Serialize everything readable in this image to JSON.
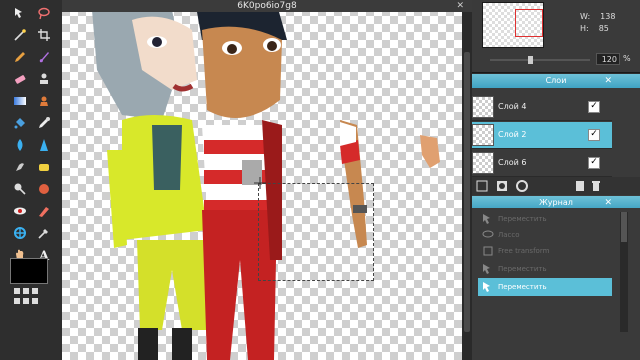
{
  "document": {
    "title": "6K0po6io7g8"
  },
  "navigator": {
    "width_label": "W:",
    "width_value": "138",
    "height_label": "H:",
    "height_value": "85",
    "zoom_value": "120",
    "zoom_unit": "%"
  },
  "layers_panel": {
    "title": "Слои",
    "items": [
      {
        "name": "Слой 4",
        "selected": false,
        "visible": true
      },
      {
        "name": "Слой 2",
        "selected": true,
        "visible": true
      },
      {
        "name": "Слой 6",
        "selected": false,
        "visible": true
      }
    ]
  },
  "history_panel": {
    "title": "Журнал",
    "items": [
      {
        "label": "Переместить",
        "selected": false
      },
      {
        "label": "Лассо",
        "selected": false
      },
      {
        "label": "Free transform",
        "selected": false
      },
      {
        "label": "Переместить",
        "selected": false
      },
      {
        "label": "Переместить",
        "selected": true
      }
    ]
  },
  "tools": [
    "move",
    "lasso",
    "wand",
    "crop",
    "pencil",
    "brush",
    "eraser",
    "clone",
    "gradient",
    "stamp",
    "bucket",
    "smudge",
    "drop",
    "sharpen",
    "dodge",
    "sponge",
    "eye-red",
    "color-replace",
    "drawing",
    "picker",
    "hand",
    "text",
    "zoom",
    "grid"
  ],
  "colors": {
    "foreground": "#000000",
    "accent": "#5bbfd8"
  }
}
